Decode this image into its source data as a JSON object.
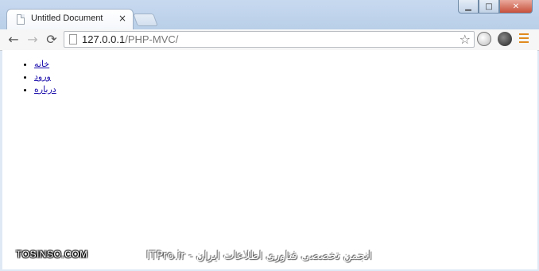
{
  "browser": {
    "tab_title": "Untitled Document",
    "tab_close": "×",
    "url_host": "127.0.0.1",
    "url_path": "/PHP-MVC/",
    "window_controls": {
      "minimize": "▁",
      "maximize": "□",
      "close": "✕"
    },
    "icons": {
      "back": "←",
      "forward": "→",
      "reload": "⟳",
      "star": "☆"
    }
  },
  "page": {
    "nav_items": [
      {
        "label": "خانه"
      },
      {
        "label": "ورود"
      },
      {
        "label": "درباره"
      }
    ]
  },
  "watermark": {
    "left": "TOSINSO.COM",
    "right": "ITPro.ir - انجمن تخصصی فناوری اطلاعات ایران"
  }
}
